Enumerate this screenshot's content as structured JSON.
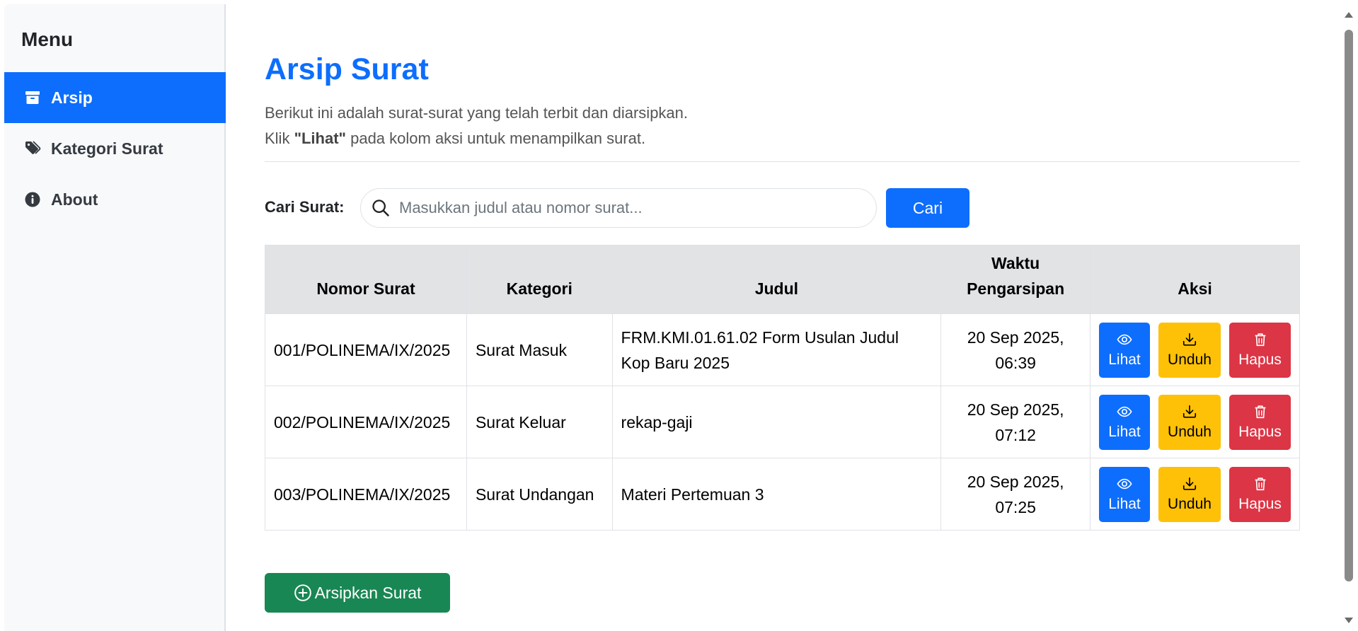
{
  "sidebar": {
    "title": "Menu",
    "items": [
      {
        "label": "Arsip",
        "icon": "archive-icon",
        "active": true
      },
      {
        "label": "Kategori Surat",
        "icon": "tags-icon",
        "active": false
      },
      {
        "label": "About",
        "icon": "info-icon",
        "active": false
      }
    ]
  },
  "main": {
    "title": "Arsip Surat",
    "desc_line1": "Berikut ini adalah surat-surat yang telah terbit dan diarsipkan.",
    "desc_line2_pre": "Klik ",
    "desc_line2_bold": "\"Lihat\"",
    "desc_line2_post": " pada kolom aksi untuk menampilkan surat."
  },
  "search": {
    "label": "Cari Surat:",
    "placeholder": "Masukkan judul atau nomor surat...",
    "value": "",
    "button": "Cari"
  },
  "table": {
    "headers": [
      "Nomor Surat",
      "Kategori",
      "Judul",
      "Waktu Pengarsipan",
      "Aksi"
    ],
    "rows": [
      {
        "nomor": "001/POLINEMA/IX/2025",
        "kategori": "Surat Masuk",
        "judul": "FRM.KMI.01.61.02 Form Usulan Judul Kop Baru 2025",
        "waktu": "20 Sep 2025, 06:39"
      },
      {
        "nomor": "002/POLINEMA/IX/2025",
        "kategori": "Surat Keluar",
        "judul": "rekap-gaji",
        "waktu": "20 Sep 2025, 07:12"
      },
      {
        "nomor": "003/POLINEMA/IX/2025",
        "kategori": "Surat Undangan",
        "judul": "Materi Pertemuan 3",
        "waktu": "20 Sep 2025, 07:25"
      }
    ],
    "actions": {
      "view": "Lihat",
      "download": "Unduh",
      "delete": "Hapus"
    }
  },
  "archive_button": "Arsipkan Surat",
  "colors": {
    "primary": "#0d6efd",
    "warning": "#ffc107",
    "danger": "#dc3545",
    "success": "#198754",
    "header_bg": "#e2e3e5",
    "sidebar_bg": "#f8f9fa"
  }
}
